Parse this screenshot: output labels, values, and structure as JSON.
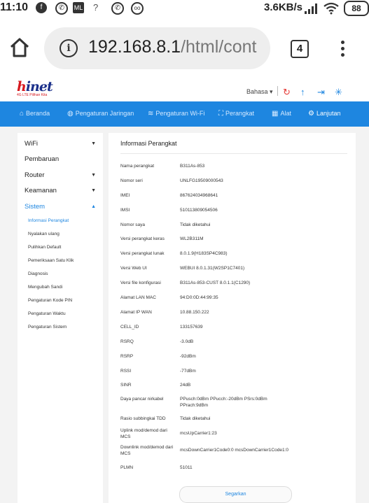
{
  "status_bar": {
    "time": "11:10",
    "network_speed": "3.6KB/s",
    "battery": "88",
    "notification_icons": [
      "facebook-icon",
      "whatsapp-icon",
      "ml-icon",
      "wifi-question-icon",
      "whatsapp-icon",
      "tripadvisor-icon"
    ]
  },
  "browser": {
    "url_host": "192.168.8.1",
    "url_path": "/html/cont",
    "tab_count": "4"
  },
  "router_header": {
    "logo_text": "hinet",
    "logo_subtext": "4G LTE Pilihan Kita",
    "language": "Bahasa",
    "header_icons": [
      "refresh-circle-icon",
      "upload-arrow-icon",
      "logout-icon",
      "loading-icon"
    ]
  },
  "nav": {
    "items": [
      {
        "label": "Beranda",
        "icon": "home-icon"
      },
      {
        "label": "Pengaturan Jaringan",
        "icon": "globe-icon"
      },
      {
        "label": "Pengaturan Wi-Fi",
        "icon": "wifi-icon"
      },
      {
        "label": "Perangkat",
        "icon": "device-icon"
      },
      {
        "label": "Alat",
        "icon": "tools-icon"
      },
      {
        "label": "Lanjutan",
        "icon": "gear-icon"
      }
    ],
    "active": "Lanjutan"
  },
  "sidebar": {
    "items": [
      {
        "label": "WiFi",
        "caret": "down"
      },
      {
        "label": "Pembaruan",
        "caret": ""
      },
      {
        "label": "Router",
        "caret": "down"
      },
      {
        "label": "Keamanan",
        "caret": "down"
      },
      {
        "label": "Sistem",
        "caret": "up"
      }
    ],
    "subitems": [
      "Informasi Perangkat",
      "Nyalakan ulang",
      "Pulihkan Default",
      "Pemeriksaan Satu Klik",
      "Diagnosis",
      "Mengubah Sandi",
      "Pengaturan Kode PIN",
      "Pengaturan Waktu",
      "Pengaturan Sistem"
    ],
    "active_subitem": "Informasi Perangkat"
  },
  "panel": {
    "title": "Informasi Perangkat",
    "rows": [
      {
        "key": "Nama perangkat",
        "value": "B311As-853"
      },
      {
        "key": "Nomor seri",
        "value": "UNLFG19509000543"
      },
      {
        "key": "IMEI",
        "value": "867624034968641"
      },
      {
        "key": "IMSI",
        "value": "510113809054506"
      },
      {
        "key": "Nomor saya",
        "value": "Tidak diketahui"
      },
      {
        "key": "Versi perangkat keras",
        "value": "WL2B311M"
      },
      {
        "key": "Versi perangkat lunak",
        "value": "8.0.1.9(H183SP4C983)"
      },
      {
        "key": "Versi Web UI",
        "value": "WEBUI 8.0.1.31(W2SP1C7401)"
      },
      {
        "key": "Versi file konfigurasi",
        "value": "B311As-853-CUST 8.0.1.1(C1290)"
      },
      {
        "key": "Alamat LAN MAC",
        "value": "94:D0:0D:44:99:35"
      },
      {
        "key": "Alamat IP WAN",
        "value": "10.88.150.222"
      },
      {
        "key": "CELL_ID",
        "value": "133157639"
      },
      {
        "key": "RSRQ",
        "value": "-3.0dB"
      },
      {
        "key": "RSRP",
        "value": "-92dBm"
      },
      {
        "key": "RSSI",
        "value": "-77dBm"
      },
      {
        "key": "SINR",
        "value": "24dB"
      },
      {
        "key": "Daya pancar nirkabel",
        "value": "PPusch:0dBm PPucch:-20dBm PSrs:0dBm PPrach:9dBm"
      },
      {
        "key": "Rasio subbingkai TDD",
        "value": "Tidak diketahui"
      },
      {
        "key": "Uplink mod/demod dari MCS",
        "value": "mcsUpCarrier1:23"
      },
      {
        "key": "Downlink mod/demod dari MCS",
        "value": "mcsDownCarrier1Code0:0 mcsDownCarrier1Code1:0"
      },
      {
        "key": "PLMN",
        "value": "51011"
      }
    ],
    "refresh_label": "Segarkan"
  },
  "colors": {
    "nav_blue": "#1e86e0",
    "logo_red": "#d6191f",
    "logo_blue": "#1a2f8a"
  }
}
